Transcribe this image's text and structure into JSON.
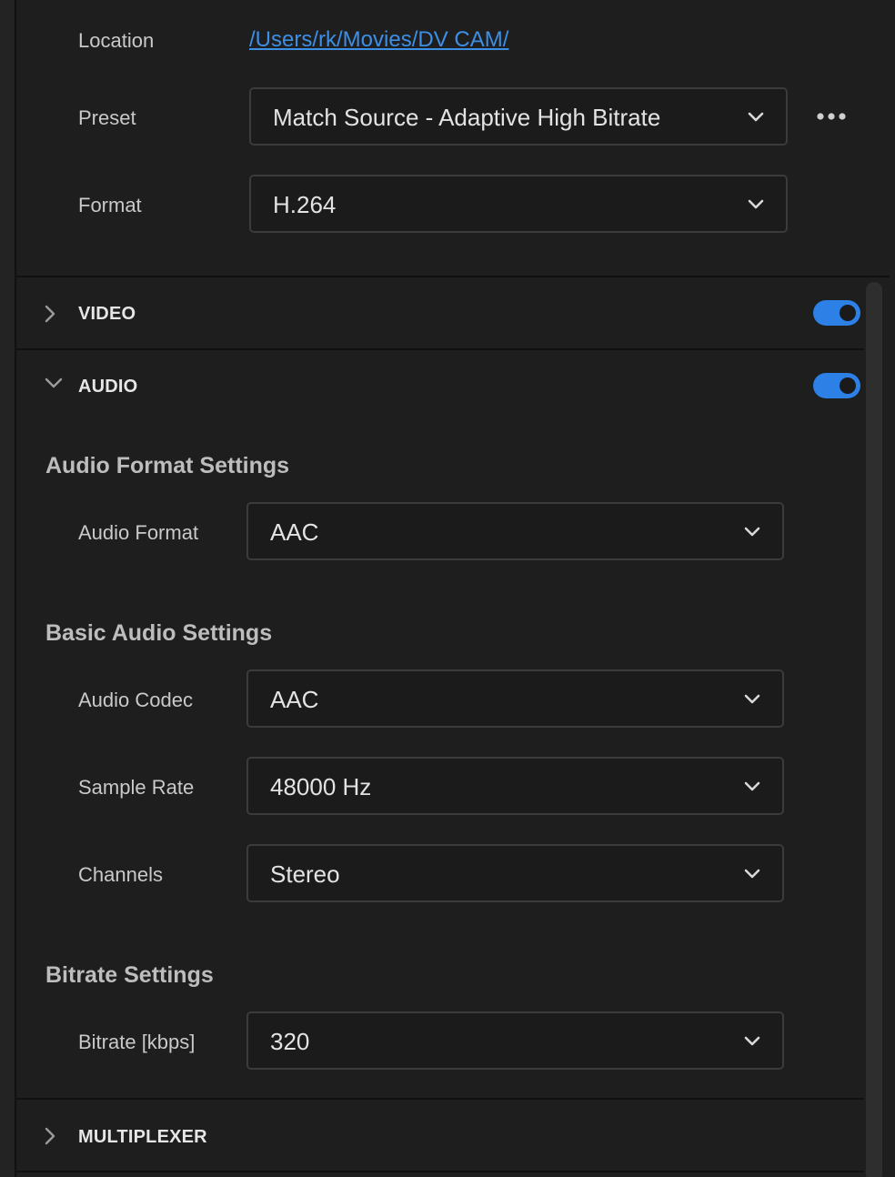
{
  "output": {
    "location_label": "Location",
    "location_path": "/Users/rk/Movies/DV CAM/",
    "preset_label": "Preset",
    "preset_value": "Match Source - Adaptive High Bitrate",
    "format_label": "Format",
    "format_value": "H.264"
  },
  "sections": {
    "video": {
      "title": "VIDEO",
      "enabled": true,
      "expanded": false
    },
    "audio": {
      "title": "AUDIO",
      "enabled": true,
      "expanded": true
    },
    "multiplexer": {
      "title": "MULTIPLEXER",
      "expanded": false
    }
  },
  "audio": {
    "format_group": {
      "title": "Audio Format Settings",
      "audio_format_label": "Audio Format",
      "audio_format_value": "AAC"
    },
    "basic_group": {
      "title": "Basic Audio Settings",
      "codec_label": "Audio Codec",
      "codec_value": "AAC",
      "sample_rate_label": "Sample Rate",
      "sample_rate_value": "48000 Hz",
      "channels_label": "Channels",
      "channels_value": "Stereo"
    },
    "bitrate_group": {
      "title": "Bitrate Settings",
      "bitrate_label": "Bitrate [kbps]",
      "bitrate_value": "320"
    }
  },
  "colors": {
    "accent": "#2c80e6",
    "link": "#3d8fe6",
    "background": "#1e1e1e"
  }
}
